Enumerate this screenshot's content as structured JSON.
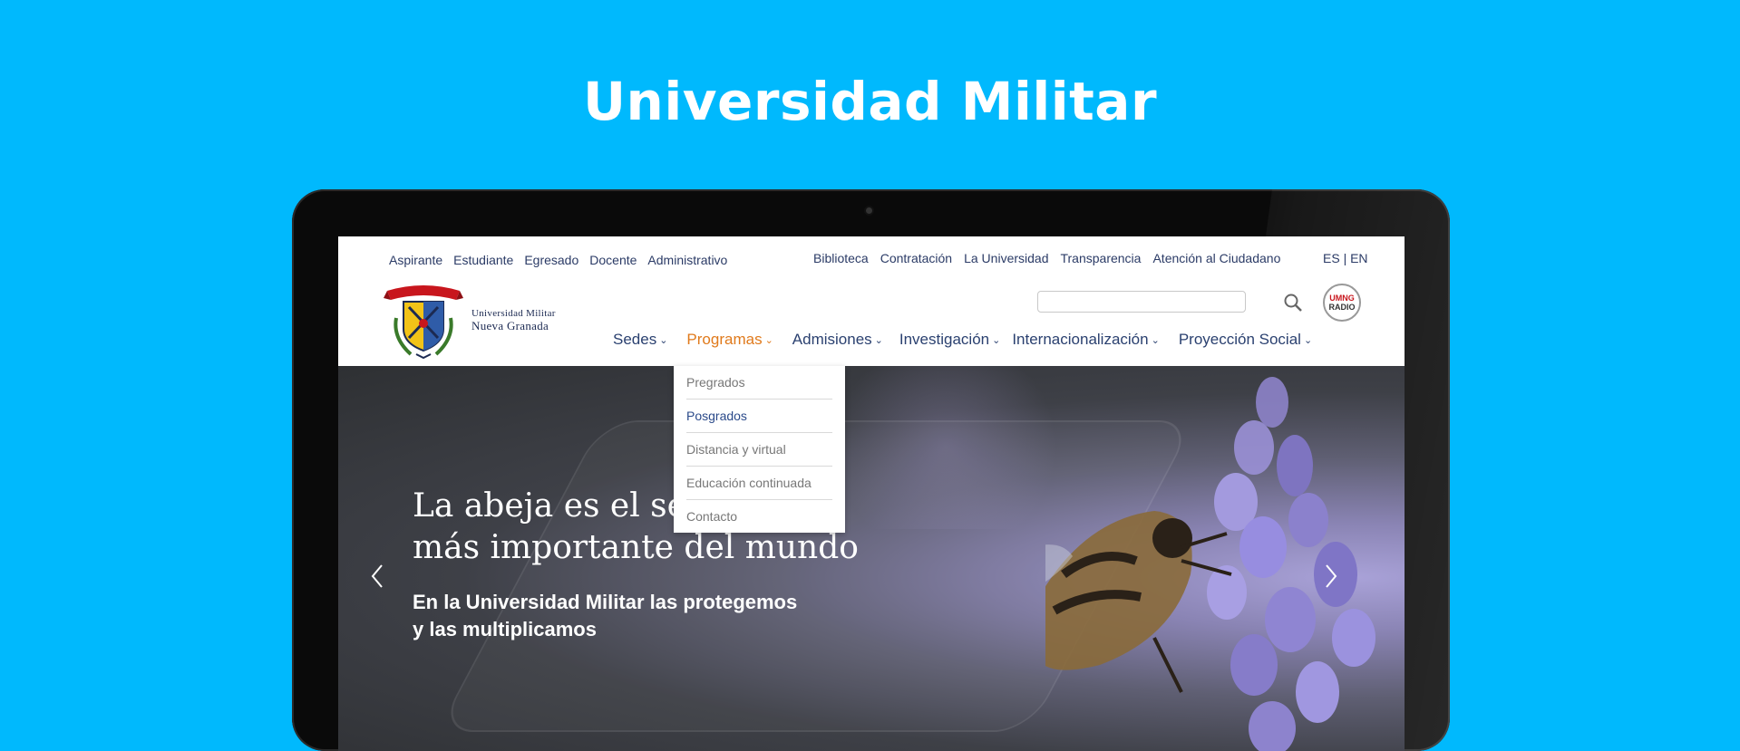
{
  "headline": "Universidad Militar",
  "site": {
    "util_left": [
      "Aspirante",
      "Estudiante",
      "Egresado",
      "Docente",
      "Administrativo"
    ],
    "util_right": [
      "Biblioteca",
      "Contratación",
      "La Universidad",
      "Transparencia",
      "Atención al Ciudadano"
    ],
    "lang": "ES | EN",
    "logo": {
      "line1": "Universidad Militar",
      "line2": "Nueva Granada"
    },
    "radio_badge": {
      "line1": "UMNG",
      "line2": "RADIO"
    },
    "nav": [
      "Sedes",
      "Programas",
      "Admisiones",
      "Investigación",
      "Internacionalización",
      "Proyección Social"
    ],
    "nav_active": "Programas",
    "dropdown": [
      "Pregrados",
      "Posgrados",
      "Distancia y virtual",
      "Educación continuada",
      "Contacto"
    ],
    "dropdown_highlight": "Posgrados",
    "hero": {
      "title_line1": "La abeja es el ser vivo",
      "title_line2": "más importante del mundo",
      "sub_line1": "En la Universidad Militar las protegemos",
      "sub_line2": "y las multiplicamos"
    }
  },
  "colors": {
    "background": "#00b9fd",
    "nav_text": "#2b4170",
    "nav_active": "#e07a1c"
  }
}
